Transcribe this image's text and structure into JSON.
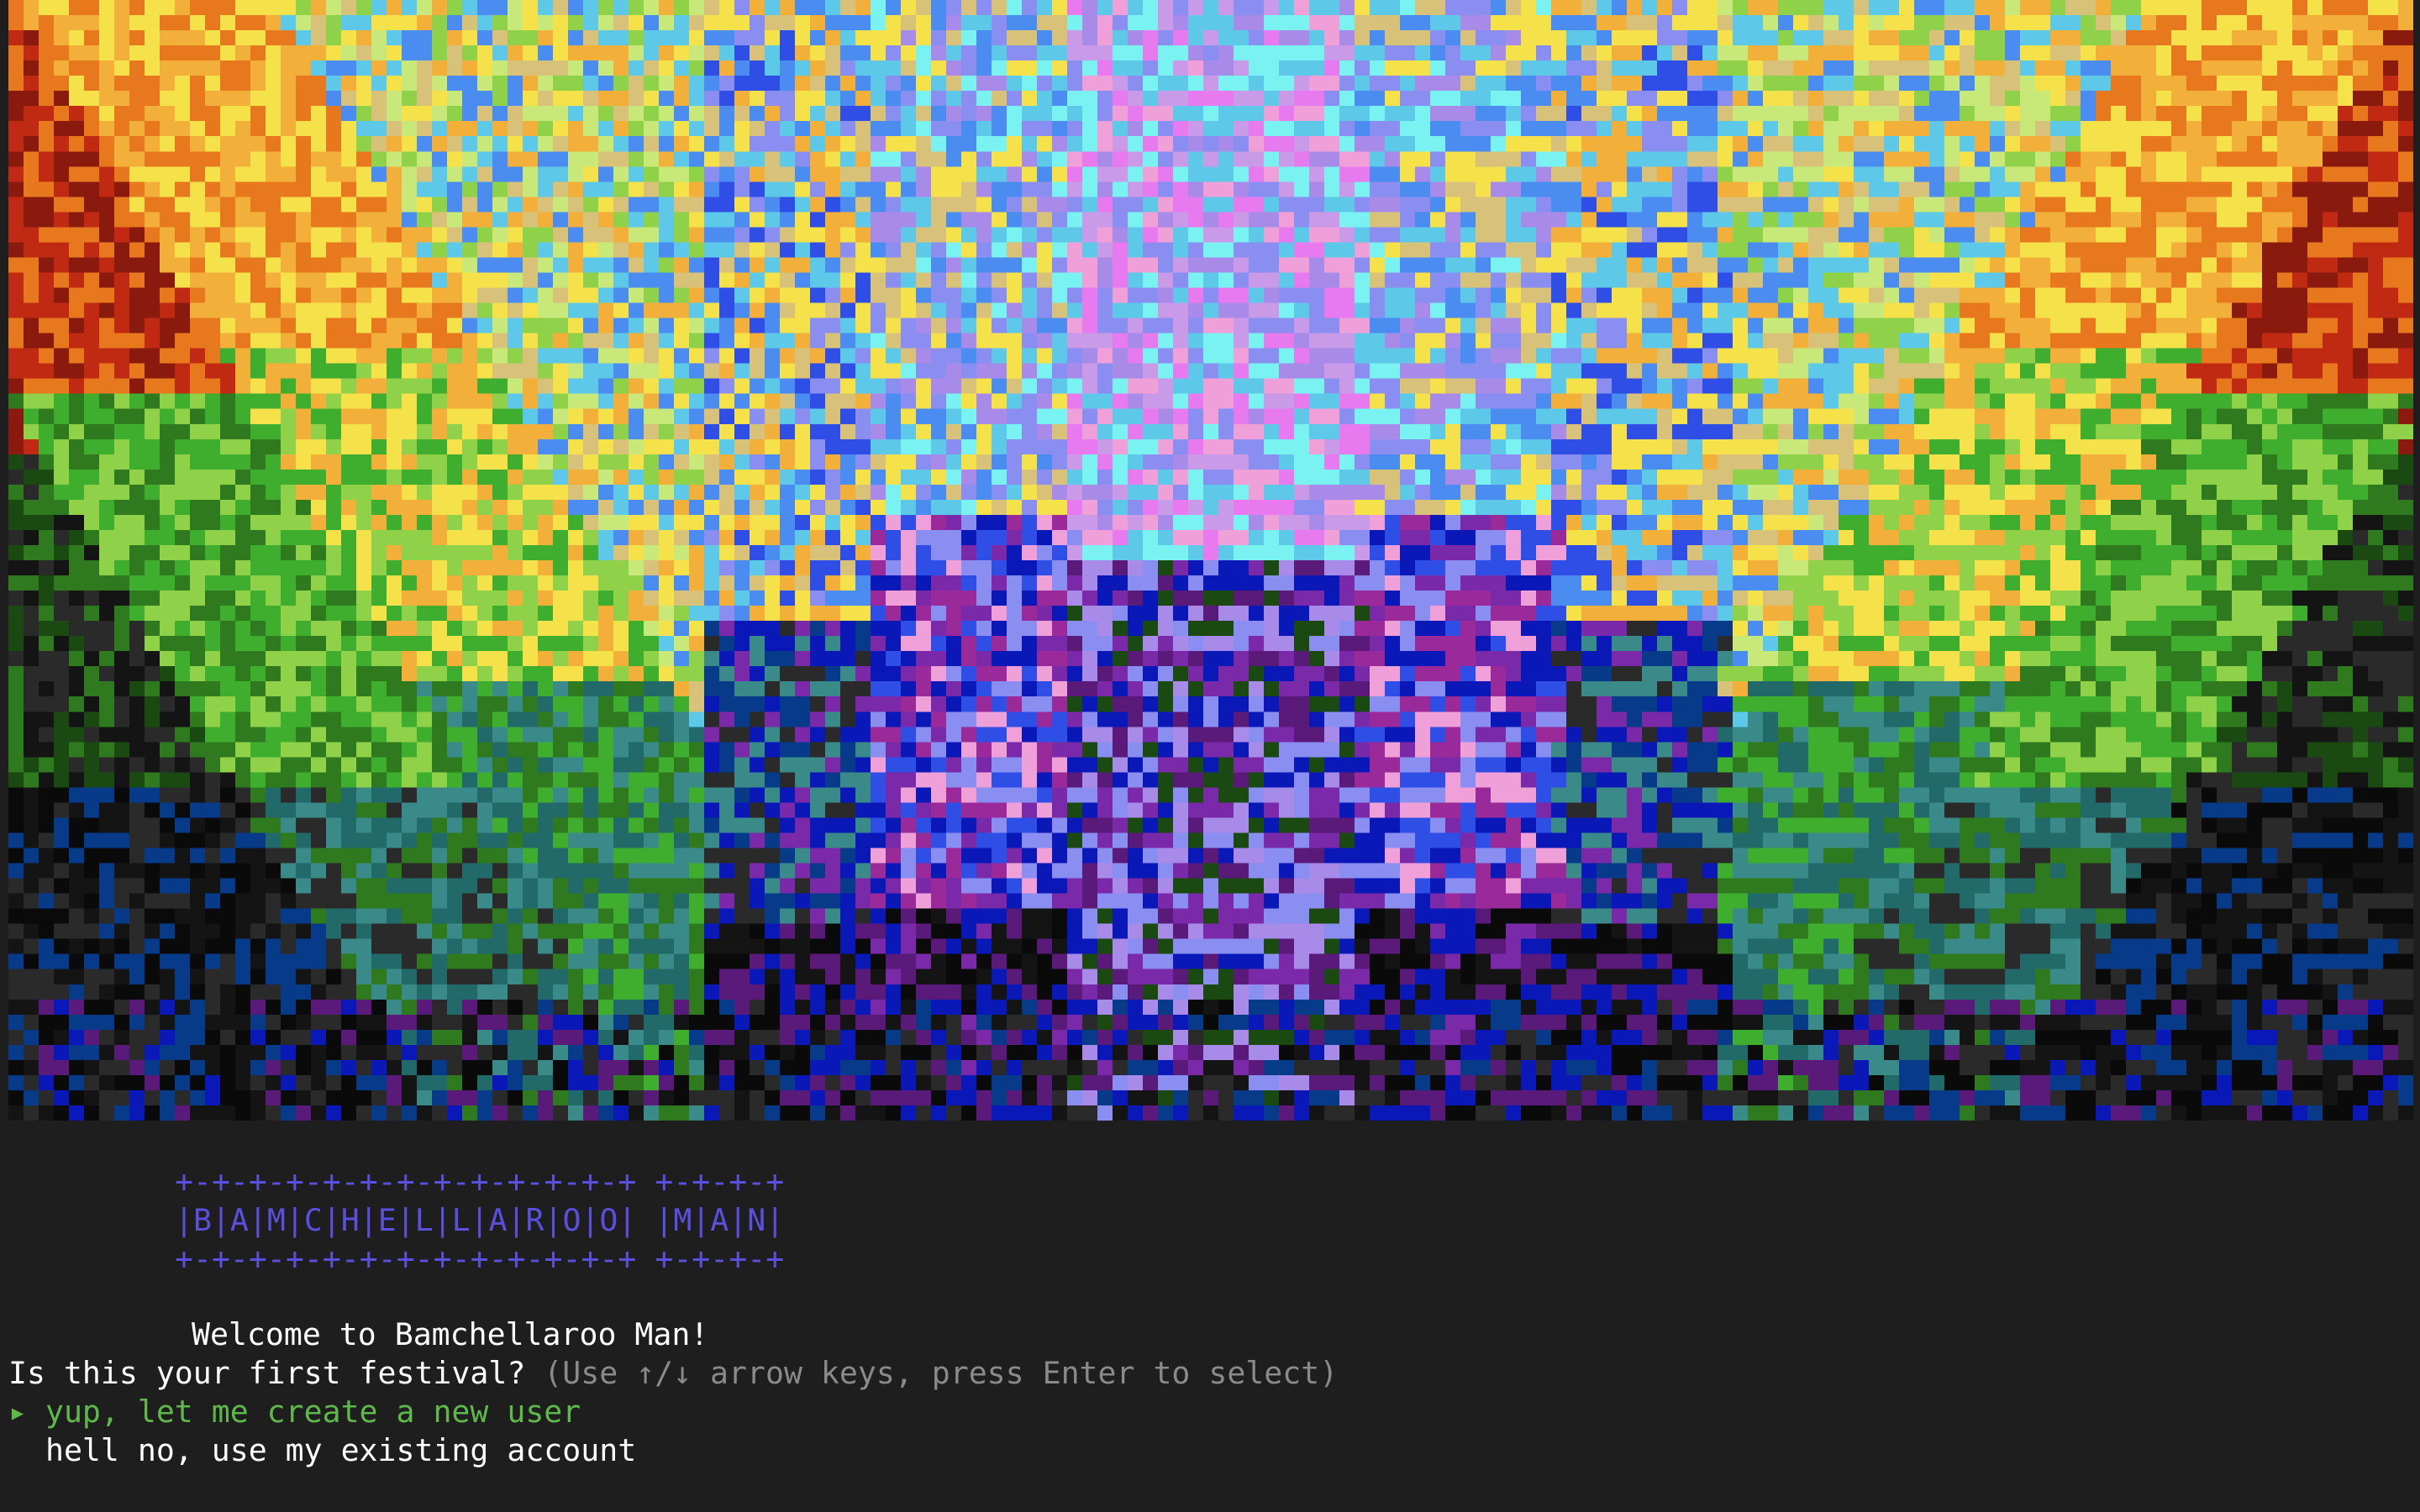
{
  "art": {
    "description_icon": "ansi-pixel-art-icon",
    "palette": [
      "#8a1a0e",
      "#c02a12",
      "#e8781e",
      "#f2b03a",
      "#f5e24a",
      "#8fd24a",
      "#3fae2e",
      "#2f7a1e",
      "#1a4a12",
      "#2a2a2a",
      "#141414",
      "#0a0a0a",
      "#083a8a",
      "#0a18b8",
      "#2e4ee6",
      "#4a8cf0",
      "#5ec8e8",
      "#7af2f2",
      "#8a8ef0",
      "#a88ae8",
      "#c89ae8",
      "#e87af0",
      "#f0a0d8",
      "#7a2aa8",
      "#5a1a7a",
      "#9a2a9a",
      "#d8c27a",
      "#c8e87a",
      "#3a8a8a",
      "#226a6a"
    ]
  },
  "banner": {
    "border_top": "+-+-+-+-+-+-+-+-+-+-+-+-+ +-+-+-+",
    "letters": "|B|A|M|C|H|E|L|L|A|R|O|O| |M|A|N|",
    "border_bottom": "+-+-+-+-+-+-+-+-+-+-+-+-+ +-+-+-+",
    "color": "#5b4fe0"
  },
  "welcome": "Welcome to Bamchellaroo Man!",
  "prompt": {
    "question": "Is this your first festival?",
    "hint": "(Use ↑/↓ arrow keys, press Enter to select)"
  },
  "options": [
    {
      "marker": "▸",
      "label": "yup, let me create a new user",
      "selected": true,
      "color": "#5fb94a"
    },
    {
      "marker": " ",
      "label": "hell no, use my existing account",
      "selected": false,
      "color": "#ffffff"
    }
  ]
}
